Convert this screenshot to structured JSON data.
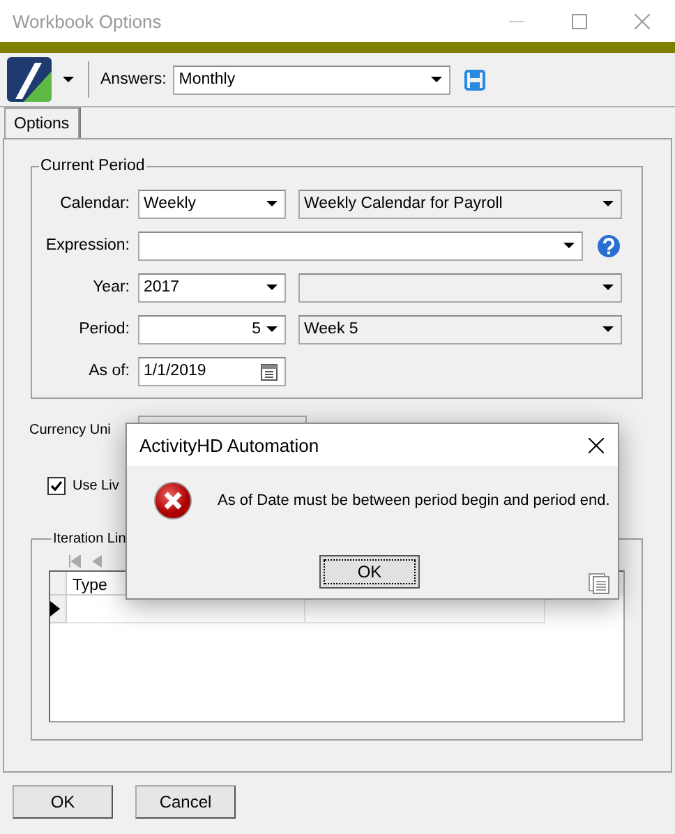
{
  "window": {
    "title": "Workbook Options"
  },
  "toolbar": {
    "answers_label": "Answers:",
    "answers_value": "Monthly"
  },
  "tabs": [
    {
      "label": "Options",
      "selected": true
    }
  ],
  "current_period": {
    "title": "Current Period",
    "rows": [
      {
        "label": "Calendar:",
        "kind": "pair",
        "value": "Weekly",
        "detail": {
          "value": "Weekly Calendar for Payroll",
          "disabled": true
        }
      },
      {
        "label": "Expression:",
        "kind": "wide"
      },
      {
        "label": "Year:",
        "kind": "pair",
        "value": "2017",
        "detail": {
          "disabled": true
        }
      },
      {
        "label": "Period:",
        "kind": "number",
        "value": "5",
        "detail": {
          "value": "Week 5",
          "disabled": true
        }
      },
      {
        "label": "As of:",
        "kind": "date",
        "value": "1/1/2019"
      }
    ]
  },
  "currency": {
    "label": "Currency Uni"
  },
  "use_live": {
    "label": "Use Liv",
    "checked": true
  },
  "iteration": {
    "title": "Iteration Lin",
    "table": {
      "columns": [
        "Type"
      ],
      "rows": [
        {
          "current": true
        }
      ]
    }
  },
  "buttons": [
    {
      "label": "OK"
    },
    {
      "label": "Cancel"
    }
  ],
  "dialog": {
    "title": "ActivityHD Automation",
    "message": "As of Date must be between period begin and period end.",
    "button": "OK"
  }
}
